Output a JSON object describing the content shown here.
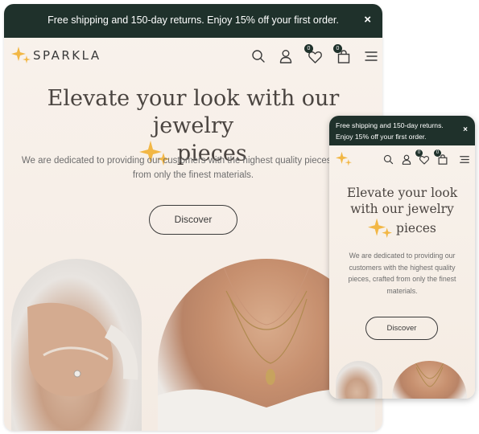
{
  "announcement": {
    "text": "Free shipping and 150-day returns. Enjoy 15% off your first order.",
    "close_symbol": "×"
  },
  "brand": {
    "name": "SPARKLA",
    "accent": "#f2b745",
    "dark": "#1f312b"
  },
  "header": {
    "icons": [
      "search-icon",
      "account-icon",
      "wishlist-icon",
      "cart-icon",
      "menu-icon"
    ],
    "wishlist_count": "0",
    "cart_count": "0"
  },
  "hero": {
    "headline_part1": "Elevate your look with our jewelry",
    "headline_part2": "pieces",
    "mobile_headline_part1": "Elevate your look with our jewelry",
    "description": "We are dedicated to providing our customers with the highest quality pieces, crafted from only the finest materials.",
    "button_label": "Discover"
  },
  "images": [
    "hands-with-rings-photo",
    "necklace-photo"
  ]
}
